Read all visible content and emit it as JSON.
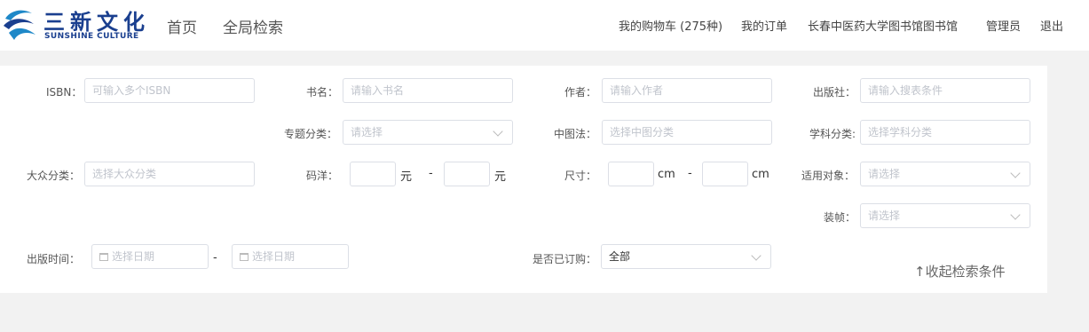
{
  "header": {
    "logo_cn": "三新文化",
    "logo_en": "SUNSHINE CULTURE",
    "nav": [
      "首页",
      "全局检索"
    ],
    "cart": "我的购物车 (275种)",
    "orders": "我的订单",
    "library": "长春中医药大学图书馆图书馆",
    "admin": "管理员",
    "logout": "退出"
  },
  "form": {
    "isbn_label": "ISBN：",
    "isbn_placeholder": "可输入多个ISBN",
    "title_label": "书名：",
    "title_placeholder": "请输入书名",
    "author_label": "作者：",
    "author_placeholder": "请输入作者",
    "publisher_label": "出版社：",
    "publisher_placeholder": "请输入搜表条件",
    "topic_label": "专题分类：",
    "topic_placeholder": "请选择",
    "clc_label": "中图法：",
    "clc_placeholder": "选择中图分类",
    "subject_label": "学科分类:",
    "subject_placeholder": "选择学科分类",
    "popular_label": "大众分类：",
    "popular_placeholder": "选择大众分类",
    "price_label": "码洋：",
    "price_unit": "元",
    "size_label": "尺寸：",
    "size_unit": "cm",
    "range_sep": "-",
    "audience_label": "适用对象：",
    "audience_placeholder": "请选择",
    "binding_label": "装帧：",
    "binding_placeholder": "请选择",
    "pubdate_label": "出版时间：",
    "date_placeholder": "选择日期",
    "ordered_label": "是否已订购：",
    "ordered_value": "全部",
    "collapse": "↑收起检索条件"
  },
  "colors": {
    "brand": "#1a3f8f",
    "logo_accent": "#1e88c8",
    "border": "#dcdfe6",
    "page_bg": "#f2f2f2"
  }
}
